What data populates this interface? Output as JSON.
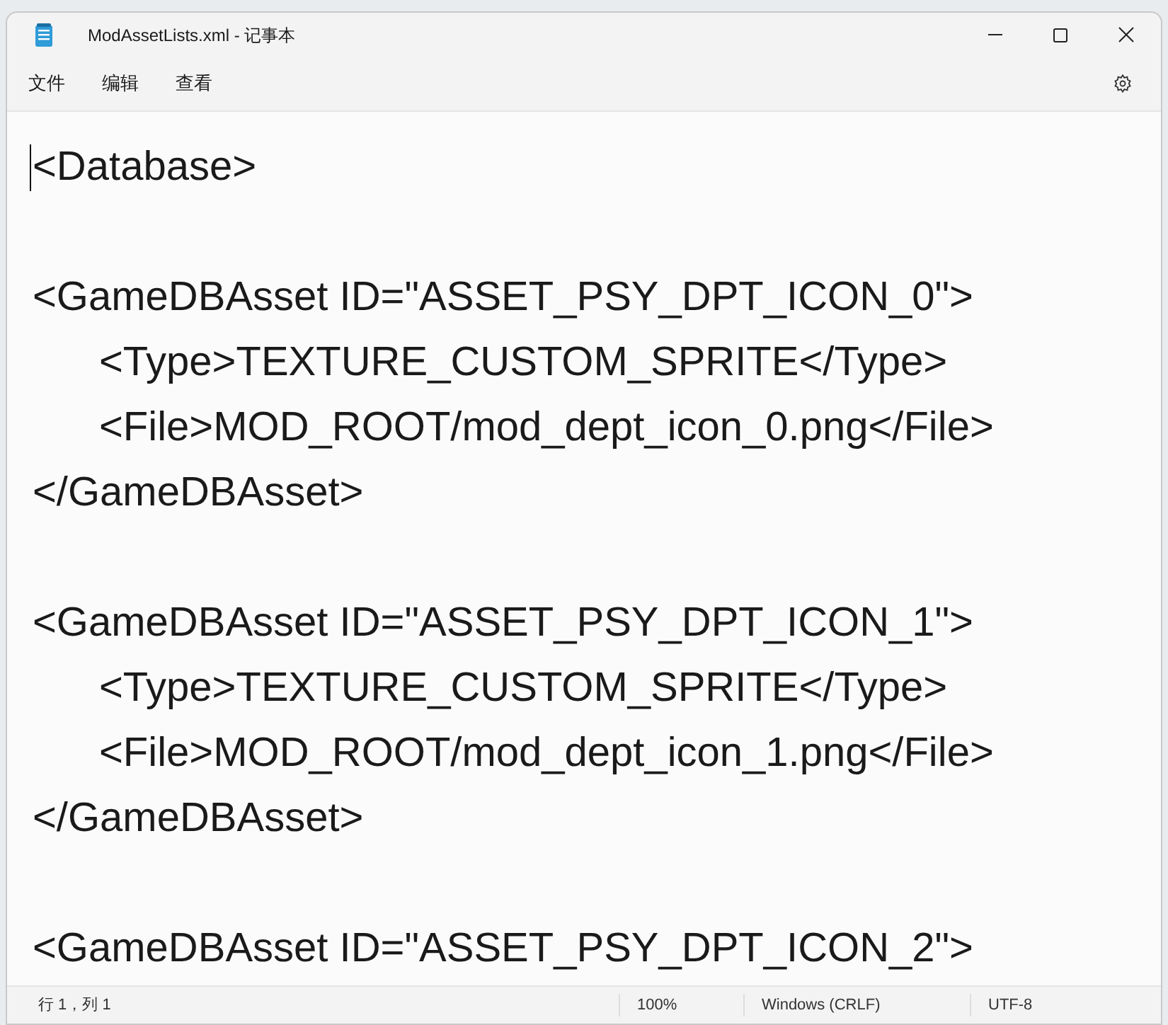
{
  "window": {
    "title": "ModAssetLists.xml - 记事本"
  },
  "menu": [
    "文件",
    "编辑",
    "查看"
  ],
  "editor": {
    "caret": true,
    "lines": [
      {
        "text": "<Database>"
      },
      {
        "text": "<GameDBAsset ID=\"ASSET_PSY_DPT_ICON_0\">",
        "children": [
          {
            "text": "<Type>TEXTURE_CUSTOM_SPRITE</Type>"
          },
          {
            "text": "<File>MOD_ROOT/mod_dept_icon_0.png</File>"
          }
        ],
        "close": "</GameDBAsset>"
      },
      {
        "text": "<GameDBAsset ID=\"ASSET_PSY_DPT_ICON_1\">",
        "children": [
          {
            "text": "<Type>TEXTURE_CUSTOM_SPRITE</Type>"
          },
          {
            "text": "<File>MOD_ROOT/mod_dept_icon_1.png</File>"
          }
        ],
        "close": "</GameDBAsset>"
      },
      {
        "text": "<GameDBAsset ID=\"ASSET_PSY_DPT_ICON_2\">"
      }
    ]
  },
  "status_bar": {
    "position": "行 1，列 1",
    "zoom": "100%",
    "line_ending": "Windows (CRLF)",
    "encoding": "UTF-8"
  }
}
